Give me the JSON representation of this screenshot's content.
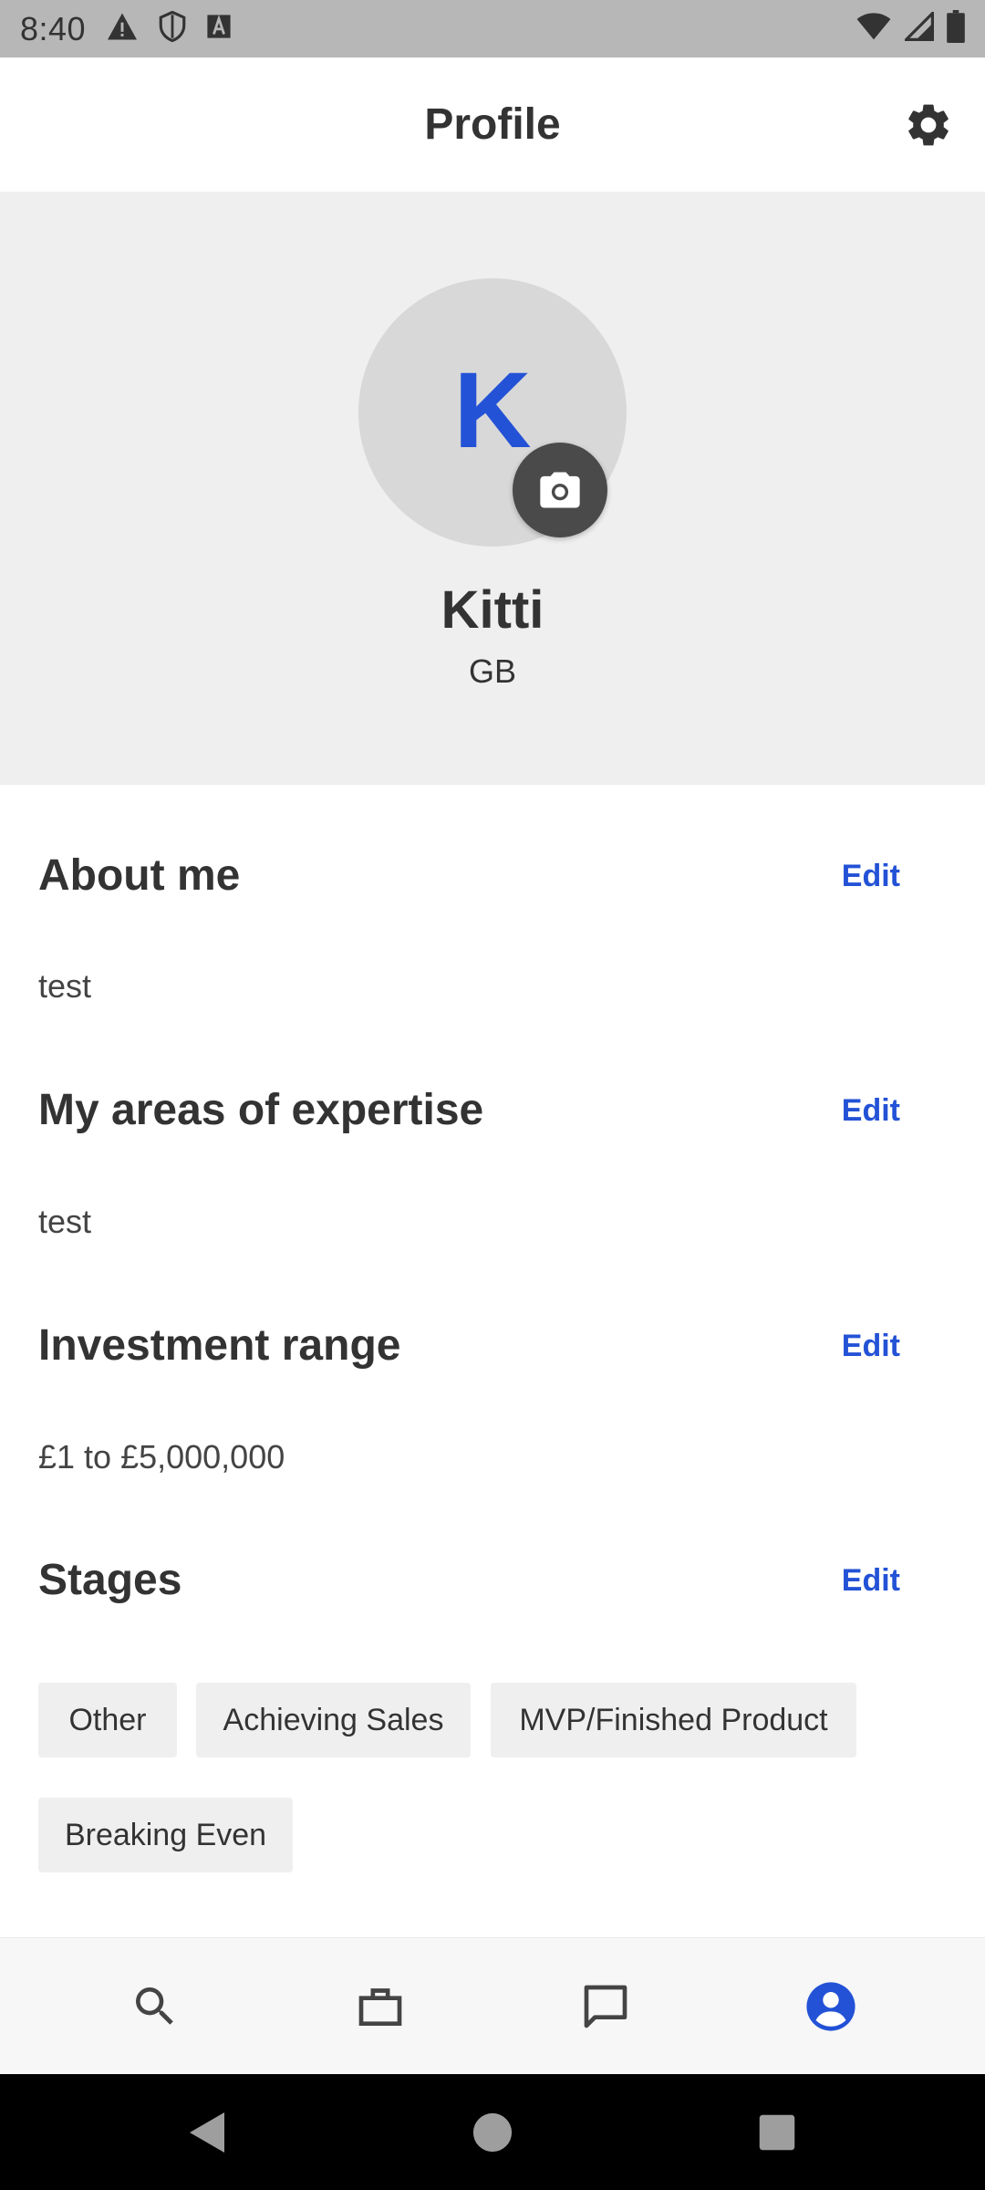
{
  "status_bar": {
    "time": "8:40",
    "left_icons": [
      "warning-icon",
      "shield-icon",
      "font-a-icon"
    ],
    "right_icons": [
      "wifi-icon",
      "signal-icon",
      "battery-icon"
    ]
  },
  "app_bar": {
    "title": "Profile",
    "settings_icon": "gear-icon"
  },
  "profile": {
    "initial": "K",
    "name": "Kitti",
    "country": "GB",
    "camera_icon": "camera-icon"
  },
  "sections": {
    "about": {
      "title": "About me",
      "edit_label": "Edit",
      "text": "test"
    },
    "expertise": {
      "title": "My areas of expertise",
      "edit_label": "Edit",
      "text": "test"
    },
    "investment": {
      "title": "Investment range",
      "edit_label": "Edit",
      "text": "£1 to £5,000,000"
    },
    "stages": {
      "title": "Stages",
      "edit_label": "Edit",
      "chips": [
        "Other",
        "Achieving Sales",
        "MVP/Finished Product",
        "Breaking Even"
      ]
    }
  },
  "bottom_nav": {
    "items": [
      {
        "icon": "search-icon",
        "active": false
      },
      {
        "icon": "briefcase-icon",
        "active": false
      },
      {
        "icon": "chat-icon",
        "active": false
      },
      {
        "icon": "profile-icon",
        "active": true
      }
    ]
  },
  "colors": {
    "accent": "#2352d6",
    "header_bg": "#efefef",
    "chip_bg": "#efefef",
    "text": "#333333"
  }
}
